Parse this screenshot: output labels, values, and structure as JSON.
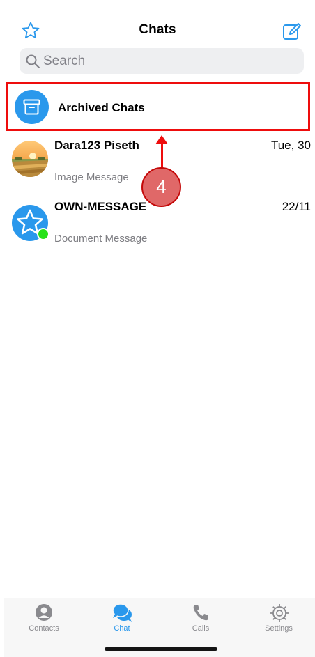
{
  "header": {
    "title": "Chats",
    "star_icon": "star-icon",
    "compose_icon": "compose-icon"
  },
  "search": {
    "placeholder": "Search"
  },
  "archived": {
    "label": "Archived Chats",
    "icon": "archive-box-icon"
  },
  "chats": [
    {
      "name": "Dara123 Piseth",
      "time": "Tue, 30",
      "preview": "Image Message"
    },
    {
      "name": "OWN-MESSAGE",
      "time": "22/11",
      "preview": "Document Message"
    }
  ],
  "annotation": {
    "step": "4"
  },
  "tabbar": {
    "tabs": [
      {
        "label": "Contacts",
        "icon": "person-icon"
      },
      {
        "label": "Chat",
        "icon": "chat-bubbles-icon"
      },
      {
        "label": "Calls",
        "icon": "phone-icon"
      },
      {
        "label": "Settings",
        "icon": "gear-icon"
      }
    ],
    "active": "Chat"
  },
  "colors": {
    "accent": "#2a98ec",
    "annotation": "#ee0d0d",
    "online": "#27e21a",
    "secondary_text": "#7d7d82"
  }
}
